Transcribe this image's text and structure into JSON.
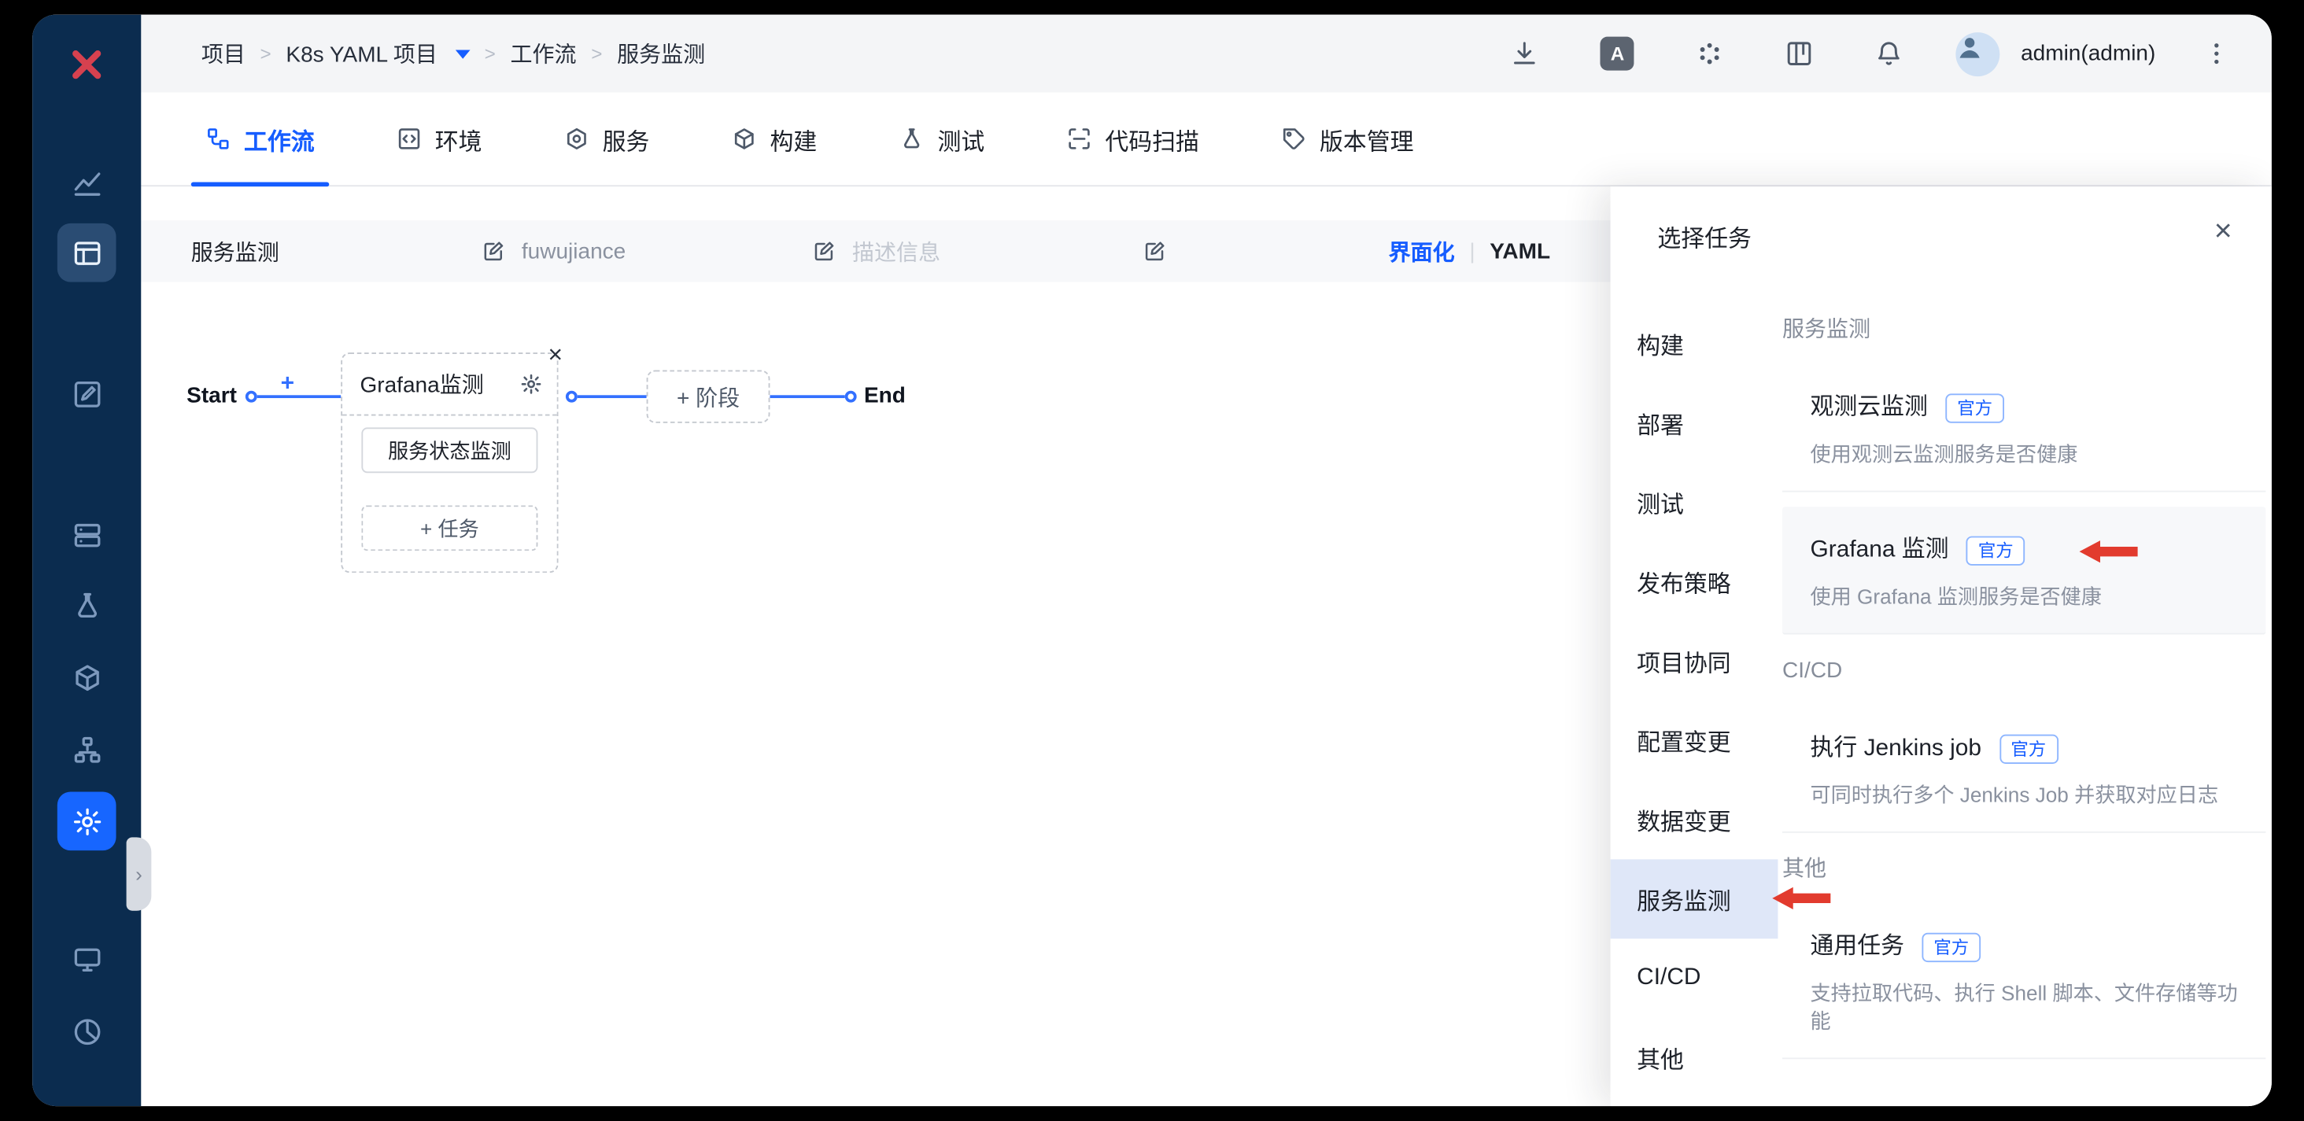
{
  "accent_color": "#165dff",
  "sidebar_color": "#0b2c4f",
  "alert_color": "#e23b2e",
  "header": {
    "breadcrumb": [
      "项目",
      "K8s YAML 项目",
      "工作流",
      "服务监测"
    ],
    "text_icon_label": "A",
    "user": "admin(admin)"
  },
  "tabs": [
    {
      "label": "工作流",
      "active": true
    },
    {
      "label": "环境",
      "active": false
    },
    {
      "label": "服务",
      "active": false
    },
    {
      "label": "构建",
      "active": false
    },
    {
      "label": "测试",
      "active": false
    },
    {
      "label": "代码扫描",
      "active": false
    },
    {
      "label": "版本管理",
      "active": false
    }
  ],
  "workflow_form": {
    "name": "服务监测",
    "identifier": "fuwujiance",
    "description_placeholder": "描述信息",
    "view_ui": "界面化",
    "view_yaml": "YAML"
  },
  "canvas": {
    "start": "Start",
    "end": "End",
    "add_node": "+",
    "stage": {
      "title": "Grafana监测",
      "tasks": [
        "服务状态监测"
      ],
      "add_task": "+ 任务"
    },
    "add_stage": "+ 阶段"
  },
  "drawer": {
    "title": "选择任务",
    "categories": [
      "构建",
      "部署",
      "测试",
      "发布策略",
      "项目协同",
      "配置变更",
      "数据变更",
      "服务监测",
      "CI/CD",
      "其他"
    ],
    "selected_category": "服务监测",
    "sections": [
      {
        "title": "服务监测",
        "cards": [
          {
            "title": "观测云监测",
            "tag": "官方",
            "desc": "使用观测云监测服务是否健康"
          },
          {
            "title": "Grafana 监测",
            "tag": "官方",
            "desc": "使用 Grafana 监测服务是否健康"
          }
        ]
      },
      {
        "title": "CI/CD",
        "cards": [
          {
            "title": "执行 Jenkins job",
            "tag": "官方",
            "desc": "可同时执行多个 Jenkins Job 并获取对应日志"
          }
        ]
      },
      {
        "title": "其他",
        "cards": [
          {
            "title": "通用任务",
            "tag": "官方",
            "desc": "支持拉取代码、执行 Shell 脚本、文件存储等功能"
          }
        ]
      }
    ]
  }
}
